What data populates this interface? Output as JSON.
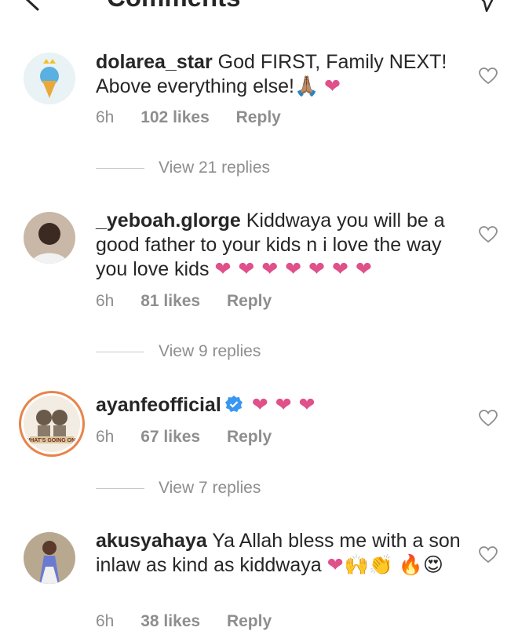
{
  "header": {
    "title": "Comments"
  },
  "comments": [
    {
      "username": "dolarea_star",
      "text": "God FIRST, Family NEXT! Above everything else!",
      "emoji": "🙏🏽",
      "hearts": "❤",
      "time": "6h",
      "likes": "102 likes",
      "reply": "Reply",
      "view_replies": "View 21 replies"
    },
    {
      "username": "_yeboah.glorge",
      "text": "Kiddwaya you will be a good father to your kids n i love the way you love kids",
      "hearts": "❤ ❤ ❤ ❤ ❤ ❤ ❤",
      "time": "6h",
      "likes": "81 likes",
      "reply": "Reply",
      "view_replies": "View 9 replies"
    },
    {
      "username": "ayanfeofficial",
      "verified": true,
      "hearts": "❤ ❤ ❤",
      "time": "6h",
      "likes": "67 likes",
      "reply": "Reply",
      "view_replies": "View 7 replies",
      "avatar_caption": "WHAT'S GOING ON?"
    },
    {
      "username": "akusyahaya",
      "text": "Ya Allah bless me with a son inlaw as kind as kiddwaya",
      "hearts": "❤",
      "emoji": "🙌👏 🔥😍",
      "time": "6h",
      "likes": "38 likes",
      "reply": "Reply"
    }
  ],
  "colors": {
    "heart": "#e0508a",
    "verified": "#3897f0",
    "muted": "#8e8e8e",
    "story_ring": "#e8844a"
  }
}
